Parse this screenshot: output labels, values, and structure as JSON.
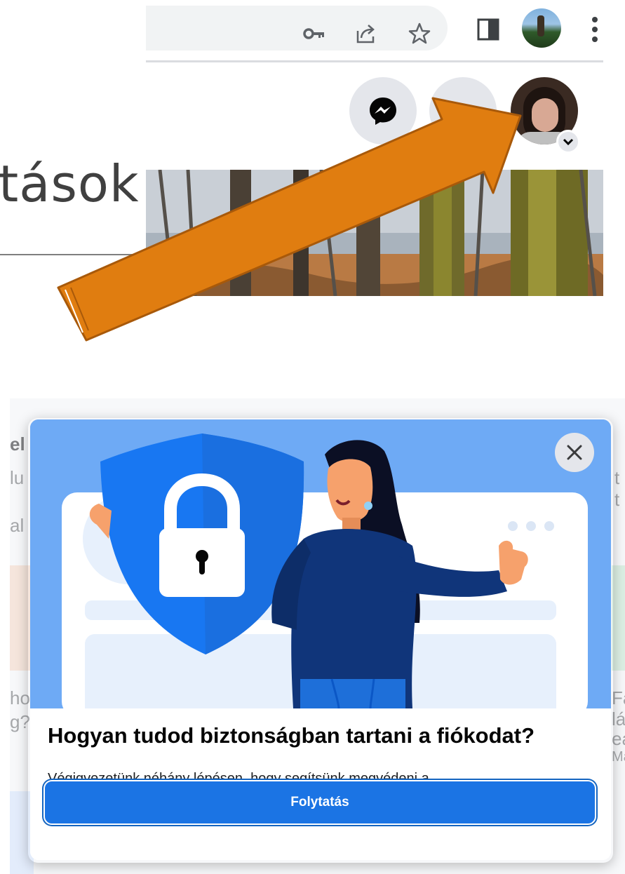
{
  "slide": {
    "partial_heading": "tások"
  },
  "browser": {
    "icons": [
      "key-icon",
      "share-icon",
      "star-icon",
      "side-panel-icon",
      "profile-avatar-icon",
      "more-vert-icon"
    ]
  },
  "facebook_header": {
    "buttons": [
      "messenger-icon",
      "notifications-icon",
      "profile-avatar",
      "chevron-down-icon"
    ]
  },
  "background_page": {
    "fragments": [
      "el",
      "lu",
      "al",
      "ho",
      "g?",
      "t t",
      "Fa",
      "lá",
      "eá",
      "Ma"
    ]
  },
  "modal": {
    "title": "Hogyan tudod biztonságban tartani a fiókodat?",
    "body": "Végigvezetünk néhány lépésen, hogy segítsünk megvédeni a",
    "continue_label": "Folytatás",
    "close_icon": "close-icon"
  },
  "colors": {
    "annotation_arrow": "#e07d10",
    "facebook_blue": "#1b74e4",
    "illustration_bg": "#6eaaf5",
    "shield_blue": "#1877f2"
  }
}
